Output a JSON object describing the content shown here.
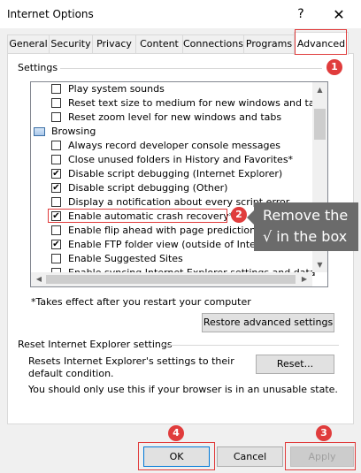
{
  "window": {
    "title": "Internet Options",
    "help_glyph": "?",
    "close_glyph": "✕"
  },
  "tabs": [
    "General",
    "Security",
    "Privacy",
    "Content",
    "Connections",
    "Programs",
    "Advanced"
  ],
  "settings": {
    "group_label": "Settings",
    "items": [
      {
        "type": "checkbox",
        "checked": false,
        "label": "Play system sounds"
      },
      {
        "type": "checkbox",
        "checked": false,
        "label": "Reset text size to medium for new windows and tabs"
      },
      {
        "type": "checkbox",
        "checked": false,
        "label": "Reset zoom level for new windows and tabs"
      },
      {
        "type": "category",
        "label": "Browsing"
      },
      {
        "type": "checkbox",
        "checked": false,
        "label": "Always record developer console messages"
      },
      {
        "type": "checkbox",
        "checked": false,
        "label": "Close unused folders in History and Favorites*"
      },
      {
        "type": "checkbox",
        "checked": true,
        "label": "Disable script debugging (Internet Explorer)"
      },
      {
        "type": "checkbox",
        "checked": true,
        "label": "Disable script debugging (Other)"
      },
      {
        "type": "checkbox",
        "checked": false,
        "label": "Display a notification about every script error"
      },
      {
        "type": "checkbox",
        "checked": true,
        "label": "Enable automatic crash recovery*"
      },
      {
        "type": "checkbox",
        "checked": false,
        "label": "Enable flip ahead with page prediction"
      },
      {
        "type": "checkbox",
        "checked": true,
        "label": "Enable FTP folder view (outside of Internet Explorer)"
      },
      {
        "type": "checkbox",
        "checked": false,
        "label": "Enable Suggested Sites"
      },
      {
        "type": "checkbox",
        "checked": false,
        "label": "Enable syncing Internet Explorer settings and data"
      }
    ],
    "note": "*Takes effect after you restart your computer",
    "restore_label": "Restore advanced settings"
  },
  "reset_section": {
    "title": "Reset Internet Explorer settings",
    "description": "Resets Internet Explorer's settings to their default condition.",
    "button_label": "Reset...",
    "warning": "You should only use this if your browser is in an unusable state."
  },
  "footer": {
    "ok": "OK",
    "cancel": "Cancel",
    "apply": "Apply"
  },
  "annotations": {
    "markers": [
      "1",
      "2",
      "3",
      "4"
    ],
    "tooltip_line1": "Remove the",
    "tooltip_line2": "√ in the box",
    "color": "#e03c3c"
  },
  "scroll_glyphs": {
    "up": "▲",
    "down": "▼",
    "left": "◀",
    "right": "▶"
  },
  "checkmark_glyph": "✔"
}
